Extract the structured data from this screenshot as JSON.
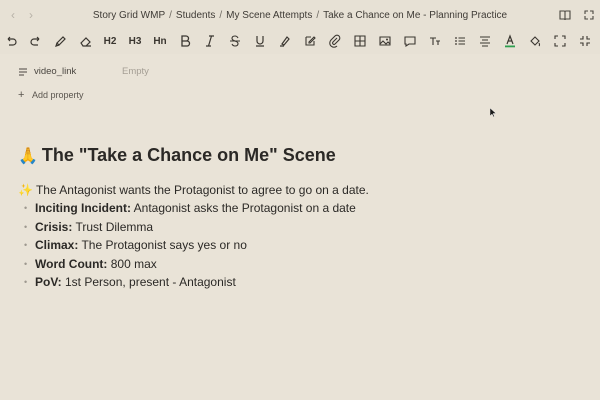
{
  "window": {
    "nav": {
      "back_label": "‹",
      "forward_label": "›"
    },
    "breadcrumb": [
      "Story Grid WMP",
      "Students",
      "My Scene Attempts",
      "Take a Chance on Me - Planning Practice"
    ],
    "breadcrumb_separator": "/",
    "icons": [
      "book-icon",
      "expand-icon"
    ]
  },
  "toolbar": {
    "h2_label": "H2",
    "h3_label": "H3",
    "hn_label": "Hn",
    "items": [
      "undo-icon",
      "redo-icon",
      "format-paint-icon",
      "eraser-icon",
      "heading-2-icon",
      "heading-3-icon",
      "heading-n-icon",
      "bold-icon",
      "italic-icon",
      "strikethrough-icon",
      "underline-icon",
      "highlight-icon",
      "edit-icon",
      "attachment-icon",
      "table-icon",
      "image-icon",
      "comment-icon",
      "text-size-icon",
      "list-icon",
      "align-icon",
      "text-color-icon",
      "fill-icon",
      "focus-icon",
      "collapse-icon"
    ],
    "text_color_accent": "#2e9e4f"
  },
  "properties": [
    {
      "name": "video_link",
      "value": "Empty"
    }
  ],
  "add_property_label": "Add property",
  "heading": {
    "emoji": "🙏",
    "text": "The \"Take a Chance on Me\" Scene"
  },
  "intro": {
    "emoji": "✨",
    "text": "The Antagonist wants the Protagonist to agree to go on a date."
  },
  "bullets": [
    {
      "label": "Inciting Incident:",
      "text": " Antagonist asks the Protagonist on a date"
    },
    {
      "label": "Crisis:",
      "text": " Trust Dilemma"
    },
    {
      "label": "Climax:",
      "text": " The Protagonist says yes or no"
    },
    {
      "label": "Word Count:",
      "text": " 800 max"
    },
    {
      "label": "PoV:",
      "text": " 1st Person, present - Antagonist"
    }
  ]
}
